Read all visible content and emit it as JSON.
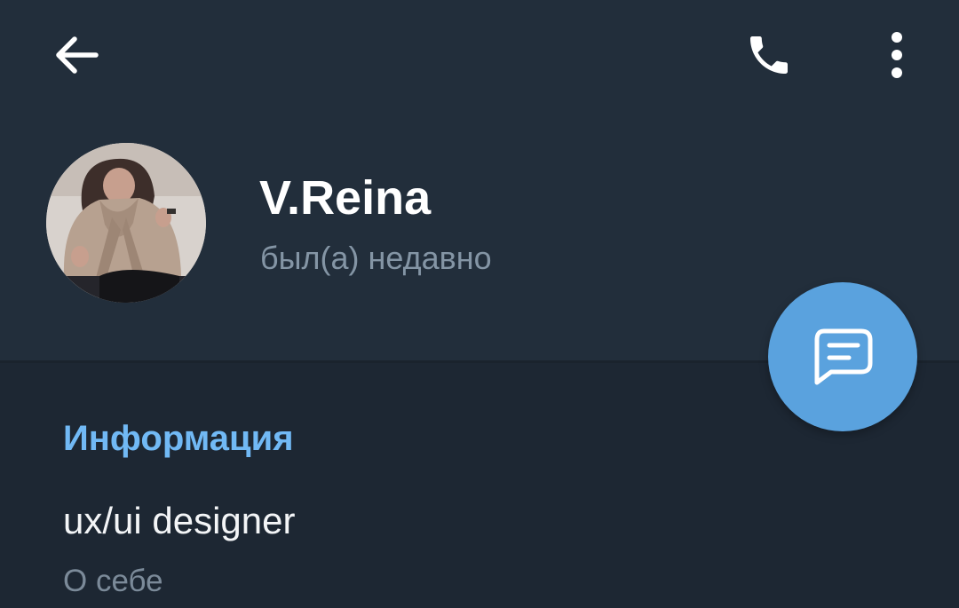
{
  "toolbar": {
    "back_icon": "arrow-left-icon",
    "call_icon": "phone-icon",
    "menu_icon": "more-vertical-icon"
  },
  "profile": {
    "name": "V.Reina",
    "status": "был(а) недавно",
    "avatar": "profile-photo"
  },
  "fab": {
    "icon": "message-icon"
  },
  "info": {
    "section_title": "Информация",
    "bio_value": "ux/ui designer",
    "bio_label": "О себе"
  },
  "colors": {
    "header_bg": "#222e3b",
    "page_bg": "#1d2733",
    "accent": "#71b9f5",
    "fab_bg": "#5aa2de",
    "muted_text": "#8495a5"
  }
}
